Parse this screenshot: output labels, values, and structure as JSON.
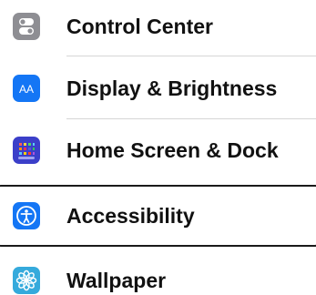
{
  "settings": {
    "items": [
      {
        "label": "Control Center",
        "icon": "control-center-icon",
        "color": "#8e8e93"
      },
      {
        "label": "Display & Brightness",
        "icon": "display-brightness-icon",
        "color": "#1476f5"
      },
      {
        "label": "Home Screen & Dock",
        "icon": "home-screen-icon",
        "color": "#3b3fc9"
      },
      {
        "label": "Accessibility",
        "icon": "accessibility-icon",
        "color": "#1476f5",
        "selected": true
      },
      {
        "label": "Wallpaper",
        "icon": "wallpaper-icon",
        "color": "#35aadc"
      }
    ]
  }
}
